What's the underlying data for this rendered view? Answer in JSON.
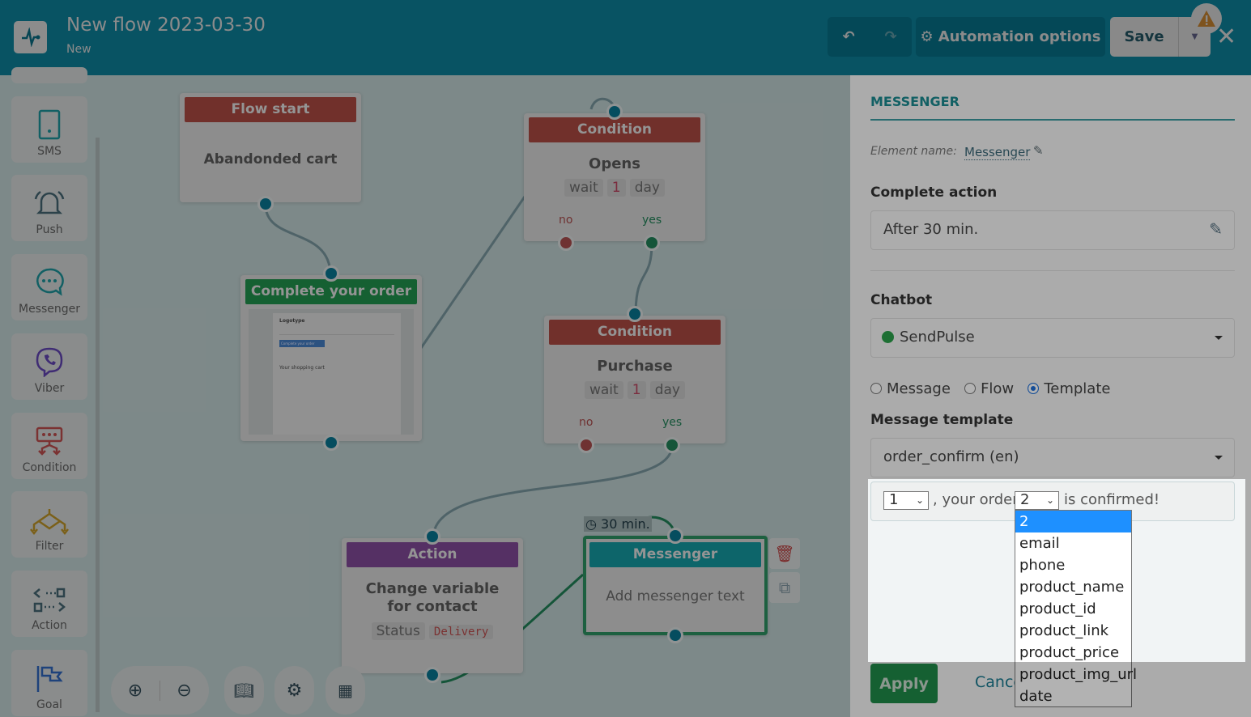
{
  "header": {
    "title": "New flow 2023-03-30",
    "status": "New",
    "automation_options": "Automation options",
    "save": "Save"
  },
  "sidebar": {
    "items": [
      {
        "label": "SMS",
        "icon": "phone-icon"
      },
      {
        "label": "Push",
        "icon": "bell-icon"
      },
      {
        "label": "Messenger",
        "icon": "chat-icon"
      },
      {
        "label": "Viber",
        "icon": "viber-icon"
      },
      {
        "label": "Condition",
        "icon": "condition-icon"
      },
      {
        "label": "Filter",
        "icon": "filter-icon"
      },
      {
        "label": "Action",
        "icon": "action-icon"
      },
      {
        "label": "Goal",
        "icon": "flag-icon"
      }
    ]
  },
  "canvas": {
    "flow_start": {
      "header": "Flow start",
      "body": "Abandonded cart"
    },
    "email": {
      "header": "Complete your order",
      "logo": "Logotype",
      "button": "Complete your order",
      "cart": "Your shopping cart"
    },
    "cond1": {
      "header": "Condition",
      "body": "Opens",
      "wait": "wait",
      "num": "1",
      "unit": "day",
      "no": "no",
      "yes": "yes"
    },
    "cond2": {
      "header": "Condition",
      "body": "Purchase",
      "wait": "wait",
      "num": "1",
      "unit": "day",
      "no": "no",
      "yes": "yes"
    },
    "action": {
      "header": "Action",
      "body": "Change variable for contact",
      "var": "Status",
      "value": "Delivery"
    },
    "messenger": {
      "header": "Messenger",
      "body": "Add messenger text",
      "delay": "30 min."
    }
  },
  "panel": {
    "title": "MESSENGER",
    "element_name_label": "Element name:",
    "element_name": "Messenger",
    "complete_action_label": "Complete action",
    "complete_action": "After 30 min.",
    "chatbot_label": "Chatbot",
    "chatbot": "SendPulse",
    "radios": [
      {
        "label": "Message",
        "checked": false
      },
      {
        "label": "Flow",
        "checked": false
      },
      {
        "label": "Template",
        "checked": true
      }
    ],
    "template_label": "Message template",
    "template": "order_confirm (en)",
    "tpl_var1": "1",
    "tpl_text1": ", your order",
    "tpl_var2": "2",
    "tpl_text2": "is confirmed!",
    "dropdown_options": [
      "2",
      "email",
      "phone",
      "product_name",
      "product_id",
      "product_link",
      "product_price",
      "product_img_url",
      "date"
    ],
    "apply": "Apply",
    "cancel": "Cancel"
  },
  "colors": {
    "header": "#0c778f",
    "condition": "#a3463e",
    "email": "#1f8a48",
    "action": "#7a4590",
    "messenger": "#149199",
    "apply": "#1f8a48",
    "accent": "#1a8a90"
  }
}
